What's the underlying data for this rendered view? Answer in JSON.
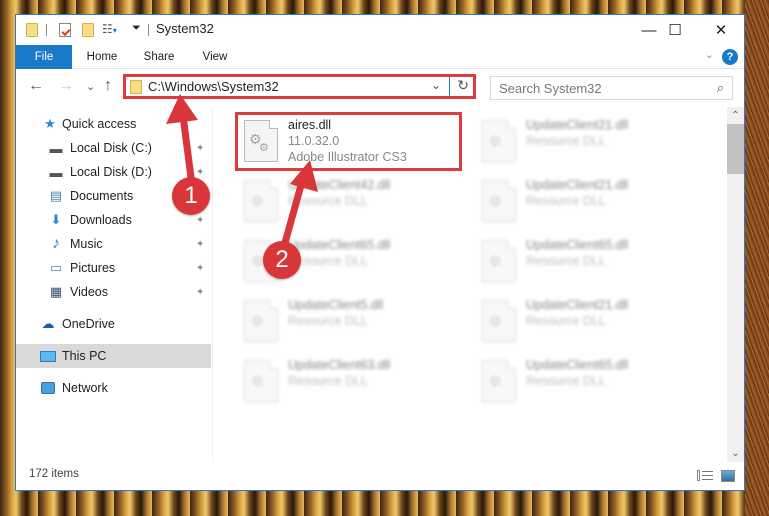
{
  "window": {
    "title": "System32",
    "controls": {
      "minimize": "—",
      "maximize": "☐",
      "close": "✕"
    }
  },
  "ribbon": {
    "tabs": [
      {
        "label": "File",
        "active": true
      },
      {
        "label": "Home"
      },
      {
        "label": "Share"
      },
      {
        "label": "View"
      }
    ],
    "help_label": "?",
    "collapse_glyph": "⌄"
  },
  "navigation": {
    "back": "←",
    "forward": "→",
    "recent": "⌄",
    "up": "↑"
  },
  "address": {
    "path": "C:\\Windows\\System32",
    "dropdown": "⌄",
    "refresh": "↻"
  },
  "search": {
    "placeholder": "Search System32",
    "icon": "⌕"
  },
  "sidebar": {
    "items": [
      {
        "label": "Quick access",
        "icon": "star-icon",
        "glyph": "★",
        "pinned": false
      },
      {
        "label": "Local Disk (C:)",
        "icon": "drive-icon",
        "glyph": "▬",
        "pinned": true
      },
      {
        "label": "Local Disk (D:)",
        "icon": "drive-icon",
        "glyph": "▬",
        "pinned": true
      },
      {
        "label": "Documents",
        "icon": "documents-icon",
        "glyph": "▤",
        "pinned": true
      },
      {
        "label": "Downloads",
        "icon": "download-icon",
        "glyph": "⬇",
        "pinned": true
      },
      {
        "label": "Music",
        "icon": "music-icon",
        "glyph": "♪",
        "pinned": true
      },
      {
        "label": "Pictures",
        "icon": "pictures-icon",
        "glyph": "▭",
        "pinned": true
      },
      {
        "label": "Videos",
        "icon": "videos-icon",
        "glyph": "▦",
        "pinned": true
      },
      {
        "label": "OneDrive",
        "icon": "cloud-icon",
        "glyph": "☁",
        "pinned": false
      },
      {
        "label": "This PC",
        "icon": "computer-icon",
        "glyph": "🖥",
        "pinned": false,
        "selected": true
      },
      {
        "label": "Network",
        "icon": "network-icon",
        "glyph": "🌐",
        "pinned": false
      }
    ],
    "pin_glyph": "📌"
  },
  "files": [
    {
      "name": "aires.dll",
      "line2": "11.0.32.0",
      "line3": "Adobe Illustrator CS3",
      "highlighted": true
    },
    {
      "name": "UpdateClient21.dll",
      "line2": "Resource DLL"
    },
    {
      "name": "UpdateClient42.dll",
      "line2": "Resource DLL"
    },
    {
      "name": "UpdateClient21.dll",
      "line2": "Resource DLL"
    },
    {
      "name": "UpdateClient65.dll",
      "line2": "Resource DLL"
    },
    {
      "name": "UpdateClient65.dll",
      "line2": "Resource DLL"
    },
    {
      "name": "UpdateClient5.dll",
      "line2": "Resource DLL"
    },
    {
      "name": "UpdateClient21.dll",
      "line2": "Resource DLL"
    },
    {
      "name": "UpdateClient63.dll",
      "line2": "Resource DLL"
    },
    {
      "name": "UpdateClient65.dll",
      "line2": "Resource DLL"
    }
  ],
  "status": {
    "item_count": "172 items"
  },
  "scrollbar": {
    "up": "⌃",
    "down": "⌄",
    "position": 0.0
  },
  "annotations": [
    {
      "number": "1",
      "target": "address bar"
    },
    {
      "number": "2",
      "target": "aires.dll"
    }
  ],
  "colors": {
    "accent": "#1979ca",
    "annotation_red": "#e0393e",
    "selected_bg": "#d9d9d9"
  }
}
